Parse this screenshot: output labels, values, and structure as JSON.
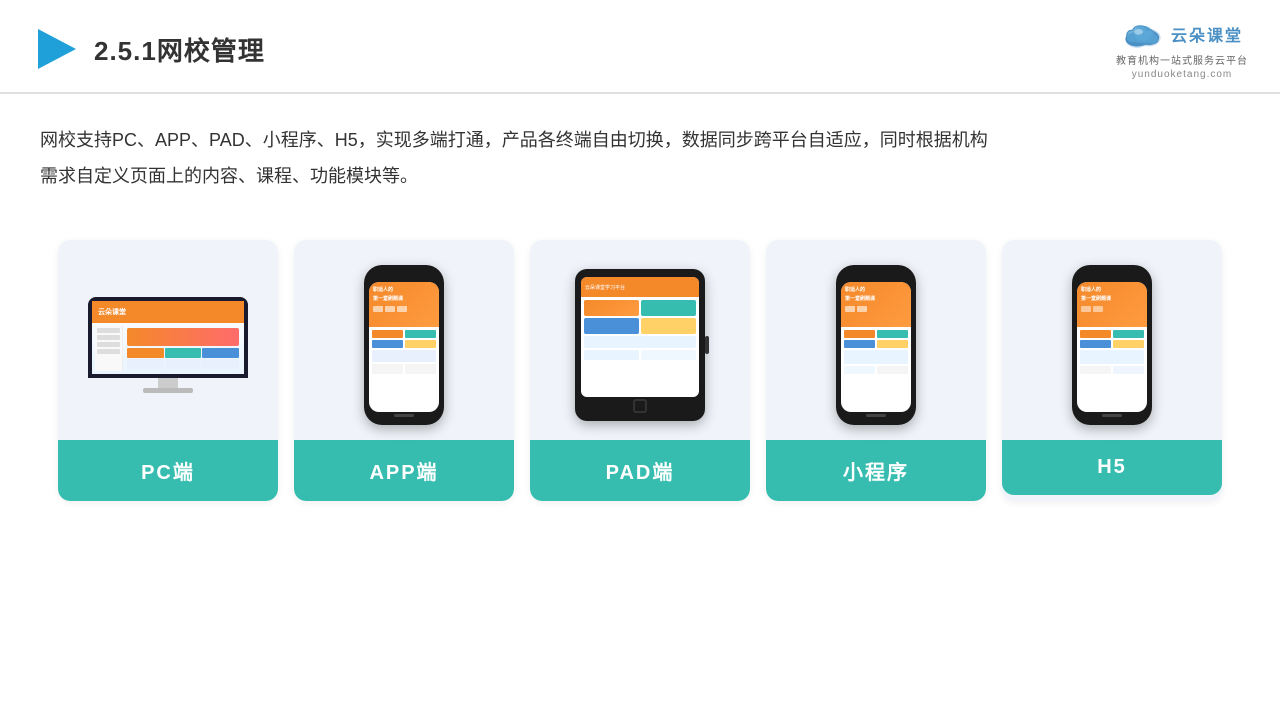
{
  "header": {
    "title_prefix": "2.5.1",
    "title_main": "网校管理",
    "logo_text": "云朵课堂",
    "logo_domain": "yunduoketang.com",
    "logo_tagline": "教育机构一站",
    "logo_tagline2": "式服务云平台"
  },
  "description": {
    "line1": "网校支持PC、APP、PAD、小程序、H5，实现多端打通，产品各终端自由切换，数据同步跨平台自适应，同时根据机构",
    "line2": "需求自定义页面上的内容、课程、功能模块等。"
  },
  "cards": [
    {
      "id": "pc",
      "label": "PC端"
    },
    {
      "id": "app",
      "label": "APP端"
    },
    {
      "id": "pad",
      "label": "PAD端"
    },
    {
      "id": "miniprogram",
      "label": "小程序"
    },
    {
      "id": "h5",
      "label": "H5"
    }
  ]
}
